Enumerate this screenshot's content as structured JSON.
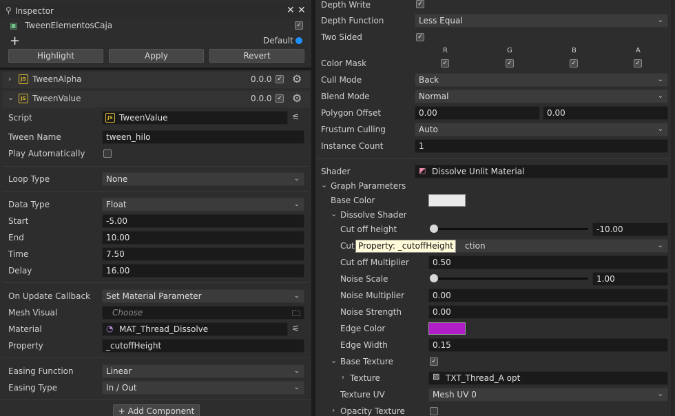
{
  "inspector": {
    "title": "Inspector",
    "entity_name": "TweenElementosCaja",
    "default_label": "Default",
    "buttons": {
      "highlight": "Highlight",
      "apply": "Apply",
      "revert": "Revert"
    }
  },
  "components": {
    "tween_alpha": {
      "name": "TweenAlpha",
      "version": "0.0.0"
    },
    "tween_value": {
      "name": "TweenValue",
      "version": "0.0.0"
    }
  },
  "tween_value": {
    "script_label": "Script",
    "script_value": "TweenValue",
    "tween_name_label": "Tween Name",
    "tween_name_value": "tween_hilo",
    "play_auto_label": "Play Automatically",
    "loop_type_label": "Loop Type",
    "loop_type_value": "None",
    "data_type_label": "Data Type",
    "data_type_value": "Float",
    "start_label": "Start",
    "start_value": "-5.00",
    "end_label": "End",
    "end_value": "10.00",
    "time_label": "Time",
    "time_value": "7.50",
    "delay_label": "Delay",
    "delay_value": "16.00",
    "on_update_label": "On Update Callback",
    "on_update_value": "Set Material Parameter",
    "mesh_visual_label": "Mesh Visual",
    "mesh_visual_placeholder": "Choose",
    "material_label": "Material",
    "material_value": "MAT_Thread_Dissolve",
    "property_label": "Property",
    "property_value": "_cutoffHeight",
    "easing_function_label": "Easing Function",
    "easing_function_value": "Linear",
    "easing_type_label": "Easing Type",
    "easing_type_value": "In / Out"
  },
  "add_component": "Add Component",
  "material": {
    "depth_write_label": "Depth Write",
    "depth_function_label": "Depth Function",
    "depth_function_value": "Less Equal",
    "two_sided_label": "Two Sided",
    "color_mask_label": "Color Mask",
    "color_mask_channels": [
      "R",
      "G",
      "B",
      "A"
    ],
    "cull_mode_label": "Cull Mode",
    "cull_mode_value": "Back",
    "blend_mode_label": "Blend Mode",
    "blend_mode_value": "Normal",
    "polygon_offset_label": "Polygon Offset",
    "polygon_offset_a": "0.00",
    "polygon_offset_b": "0.00",
    "frustum_culling_label": "Frustum Culling",
    "frustum_culling_value": "Auto",
    "instance_count_label": "Instance Count",
    "instance_count_value": "1",
    "shader_label": "Shader",
    "shader_value": "Dissolve Unlit Material",
    "graph_parameters_label": "Graph Parameters",
    "base_color_label": "Base Color",
    "base_color": "#eaeaea",
    "dissolve_shader_label": "Dissolve Shader",
    "cutoff_height_label": "Cut off height",
    "cutoff_height_value": "-10.00",
    "cutoff_height_slider": 0.0,
    "cutoff_dir_label": "Cut",
    "cutoff_dir_value": "ction",
    "tooltip": "Property: _cutoffHeight",
    "cutoff_multiplier_label": "Cut off Multiplier",
    "cutoff_multiplier_value": "0.50",
    "noise_scale_label": "Noise Scale",
    "noise_scale_value": "1.00",
    "noise_scale_slider": 0.0,
    "noise_multiplier_label": "Noise Multiplier",
    "noise_multiplier_value": "0.00",
    "noise_strength_label": "Noise Strength",
    "noise_strength_value": "0.00",
    "edge_color_label": "Edge Color",
    "edge_color": "#b01ec8",
    "edge_width_label": "Edge Width",
    "edge_width_value": "0.15",
    "base_texture_label": "Base Texture",
    "texture_label": "Texture",
    "texture_value": "TXT_Thread_A opt",
    "texture_uv_label": "Texture UV",
    "texture_uv_value": "Mesh UV 0",
    "opacity_texture_label": "Opacity Texture"
  },
  "colors": {
    "accent_blue": "#1e90ff",
    "js_yellow": "#d9b632"
  }
}
